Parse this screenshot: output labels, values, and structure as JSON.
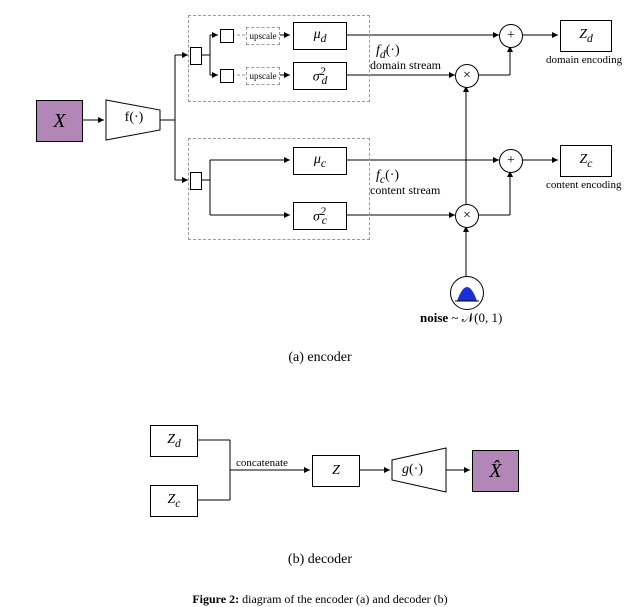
{
  "encoder": {
    "input_label": "X",
    "backbone_label": "f(·)",
    "upscale_label": "upscale",
    "mu_d_label": "μ_d",
    "sigma_d_label": "σ²_d",
    "mu_c_label": "μ_c",
    "sigma_c_label": "σ²_c",
    "fd_label": "f_d(·)",
    "domain_stream_label": "domain stream",
    "fc_label": "f_c(·)",
    "content_stream_label": "content stream",
    "noise_label": "noise ~ 𝒩(0, 1)",
    "zd_label": "Z_d",
    "zc_label": "Z_c",
    "domain_encoding_label": "domain encoding",
    "content_encoding_label": "content encoding",
    "caption": "(a) encoder"
  },
  "decoder": {
    "zd_label": "Z_d",
    "zc_label": "Z_c",
    "concat_label": "concatenate",
    "z_label": "Z",
    "g_label": "g(·)",
    "xhat_label": "X̂",
    "caption": "(b) decoder"
  },
  "figure_caption": "Figure 2: diagram of the encoder (a) and decoder (b)"
}
